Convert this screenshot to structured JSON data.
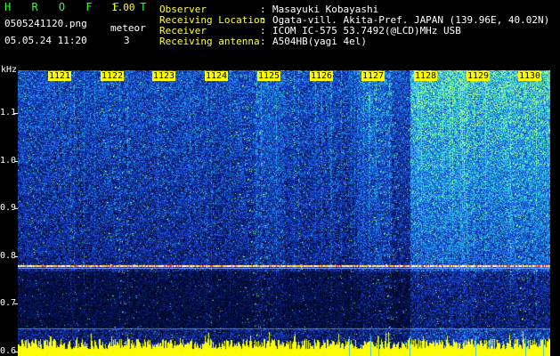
{
  "app": {
    "name": "H R O F F T",
    "version": "1.00",
    "filename": "0505241120.png",
    "datetime": "05.05.24 11:20",
    "meteor_label": "meteor",
    "meteor_count": "3"
  },
  "info": {
    "rows": [
      {
        "key": "Observer",
        "sep": ":",
        "value": "Masayuki Kobayashi"
      },
      {
        "key": "Receiving Location",
        "sep": ":",
        "value": "Ogata-vill. Akita-Pref. JAPAN (139.96E, 40.02N)"
      },
      {
        "key": "Receiver",
        "sep": ":",
        "value": "ICOM IC-575 53.7492(@LCD)MHz USB"
      },
      {
        "key": "Receiving antenna",
        "sep": ":",
        "value": "A504HB(yagi 4el)"
      }
    ]
  },
  "spectrogram": {
    "unit_label": "kHz",
    "time_labels": [
      "1121",
      "1122",
      "1123",
      "1124",
      "1125",
      "1126",
      "1127",
      "1128",
      "1129",
      "1130"
    ],
    "freq_ticks": [
      "1.1",
      "1.0",
      "0.9",
      "0.8",
      "0.7",
      "0.6"
    ],
    "freq_range_khz": [
      0.59,
      1.19
    ],
    "colors": {
      "bg": "#000000",
      "low": "#0b1a6e",
      "mid": "#1e4fd8",
      "high": "#33e0c8",
      "peak": "#ffff00"
    }
  }
}
